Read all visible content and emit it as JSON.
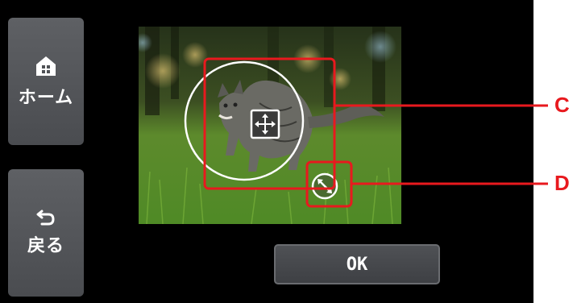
{
  "sidebar": {
    "home_label": "ホーム",
    "back_label": "戻る"
  },
  "main": {
    "ok_label": "OK"
  },
  "callouts": {
    "c": "C",
    "d": "D"
  },
  "icons": {
    "home": "home-icon",
    "back": "return-arrow-icon",
    "move": "move-arrows-icon",
    "resize": "resize-arrows-icon"
  },
  "colors": {
    "callout_red": "#e8191e",
    "screen_bg": "#000000",
    "button_gray": "#55575b"
  }
}
